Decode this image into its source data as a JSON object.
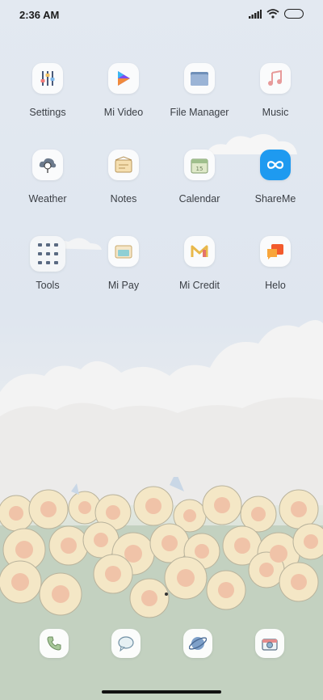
{
  "status": {
    "time": "2:36 AM"
  },
  "apps": [
    {
      "label": "Settings"
    },
    {
      "label": "Mi Video"
    },
    {
      "label": "File Manager"
    },
    {
      "label": "Music"
    },
    {
      "label": "Weather"
    },
    {
      "label": "Notes"
    },
    {
      "label": "Calendar"
    },
    {
      "label": "ShareMe"
    },
    {
      "label": "Tools"
    },
    {
      "label": "Mi Pay"
    },
    {
      "label": "Mi Credit"
    },
    {
      "label": "Helo"
    }
  ],
  "calendar_icon_day": "15",
  "dock": [
    {
      "name": "phone-icon"
    },
    {
      "name": "messages-icon"
    },
    {
      "name": "browser-icon"
    },
    {
      "name": "camera-icon"
    }
  ],
  "colors": {
    "shareme": "#1e9af0",
    "helo": "#f25a2c",
    "video": "#7b4cf0"
  }
}
